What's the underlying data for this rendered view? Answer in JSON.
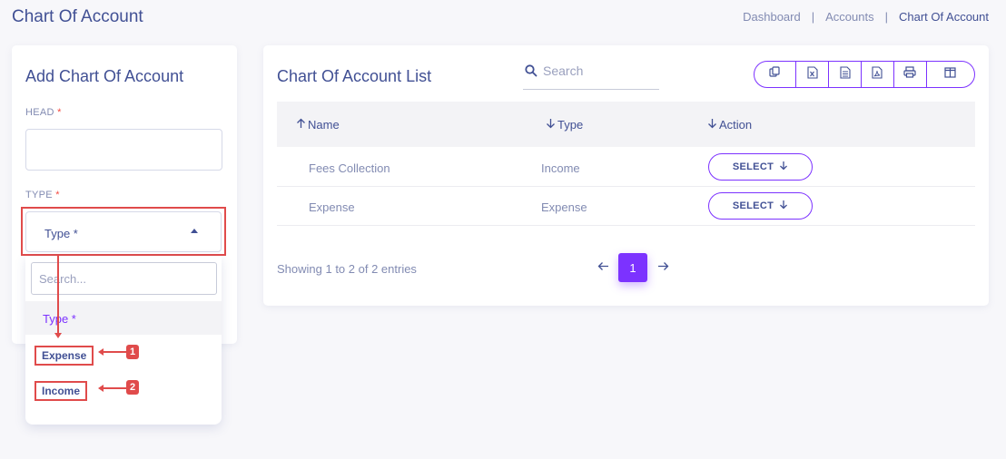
{
  "header": {
    "page_title": "Chart Of Account",
    "breadcrumb": [
      "Dashboard",
      "Accounts",
      "Chart Of Account"
    ]
  },
  "form": {
    "title": "Add Chart Of Account",
    "head_label": "HEAD",
    "type_label": "TYPE",
    "required_mark": "*",
    "type_select_value": "Type *",
    "dropdown": {
      "search_placeholder": "Search...",
      "options": [
        "Type *",
        "Expense",
        "Income"
      ]
    }
  },
  "annotations": {
    "badges": [
      "1",
      "2"
    ],
    "color": "#e04b4b"
  },
  "list": {
    "title": "Chart Of Account List",
    "search_placeholder": "Search",
    "export_icons": [
      "copy-icon",
      "excel-icon",
      "csv-icon",
      "pdf-icon",
      "print-icon",
      "columns-icon"
    ],
    "columns": [
      "Name",
      "Type",
      "Action"
    ],
    "rows": [
      {
        "name": "Fees Collection",
        "type": "Income",
        "action": "SELECT"
      },
      {
        "name": "Expense",
        "type": "Expense",
        "action": "SELECT"
      }
    ],
    "showing": "Showing 1 to 2 of 2 entries",
    "current_page": "1"
  },
  "colors": {
    "accent": "#7c32ff",
    "text": "#415094",
    "muted": "#828bb2"
  }
}
